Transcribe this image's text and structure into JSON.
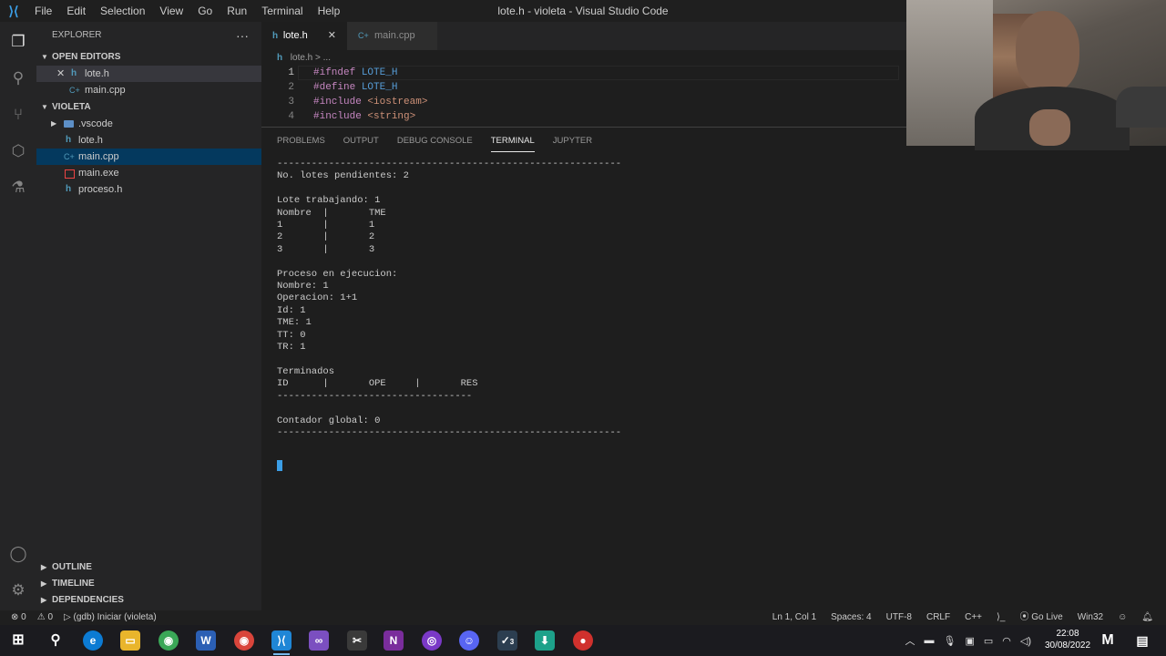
{
  "titlebar": {
    "menu": [
      "File",
      "Edit",
      "Selection",
      "View",
      "Go",
      "Run",
      "Terminal",
      "Help"
    ],
    "window_title": "lote.h - violeta - Visual Studio Code"
  },
  "activitybar": {
    "icons": [
      "explorer-icon",
      "search-icon",
      "source-control-icon",
      "extensions-icon",
      "testing-icon",
      "account-icon",
      "manage-icon"
    ]
  },
  "sidebar": {
    "title": "EXPLORER",
    "more": "···",
    "open_editors": {
      "header": "OPEN EDITORS",
      "items": [
        {
          "close": "✕",
          "icon": "h",
          "label": "lote.h"
        },
        {
          "icon": "C+",
          "label": "main.cpp"
        }
      ]
    },
    "folder": {
      "header": "VIOLETA",
      "items": [
        {
          "icon": "folder",
          "label": ".vscode"
        },
        {
          "icon": "h",
          "label": "lote.h"
        },
        {
          "icon": "C+",
          "label": "main.cpp"
        },
        {
          "icon": "exe",
          "label": "main.exe"
        },
        {
          "icon": "h",
          "label": "proceso.h"
        }
      ]
    },
    "bottom_sections": [
      "OUTLINE",
      "TIMELINE",
      "DEPENDENCIES"
    ]
  },
  "editor": {
    "tabs": [
      {
        "icon": "h",
        "label": "lote.h",
        "close": "✕"
      },
      {
        "icon": "C+",
        "label": "main.cpp"
      }
    ],
    "breadcrumb": [
      "lote.h",
      ">",
      "..."
    ],
    "lines": [
      {
        "num": "1",
        "pre": "#ifndef",
        "rest": " LOTE_H"
      },
      {
        "num": "2",
        "pre": "#define",
        "rest": " LOTE_H"
      },
      {
        "num": "3",
        "pre": "#include",
        "rest": " <iostream>"
      },
      {
        "num": "4",
        "pre": "#include",
        "rest": " <string>"
      }
    ]
  },
  "panel": {
    "tabs": [
      "PROBLEMS",
      "OUTPUT",
      "DEBUG CONSOLE",
      "TERMINAL",
      "JUPYTER"
    ],
    "active_tab": "TERMINAL",
    "terminal_text": "------------------------------------------------------------\nNo. lotes pendientes: 2\n\nLote trabajando: 1\nNombre  |       TME\n1       |       1\n2       |       2\n3       |       3\n\nProceso en ejecucion:\nNombre: 1\nOperacion: 1+1\nId: 1\nTME: 1\nTT: 0\nTR: 1\n\nTerminados\nID      |       OPE     |       RES\n----------------------------------\n\nContador global: 0\n------------------------------------------------------------"
  },
  "statusbar": {
    "errors": "⊗ 0",
    "warnings": "⚠ 0",
    "debug": "(gdb) Iniciar (violeta)",
    "position": "Ln 1, Col 1",
    "spaces": "Spaces: 4",
    "encoding": "UTF-8",
    "eol": "CRLF",
    "language": "C++",
    "golive": "Go Live",
    "platform": "Win32"
  },
  "taskbar": {
    "time": "22:08",
    "date": "30/08/2022",
    "badge": "3"
  },
  "colors": {
    "accent": "#3b9ee6",
    "status_bg": "#1f1f1f",
    "editor_bg": "#1e1e1e"
  }
}
